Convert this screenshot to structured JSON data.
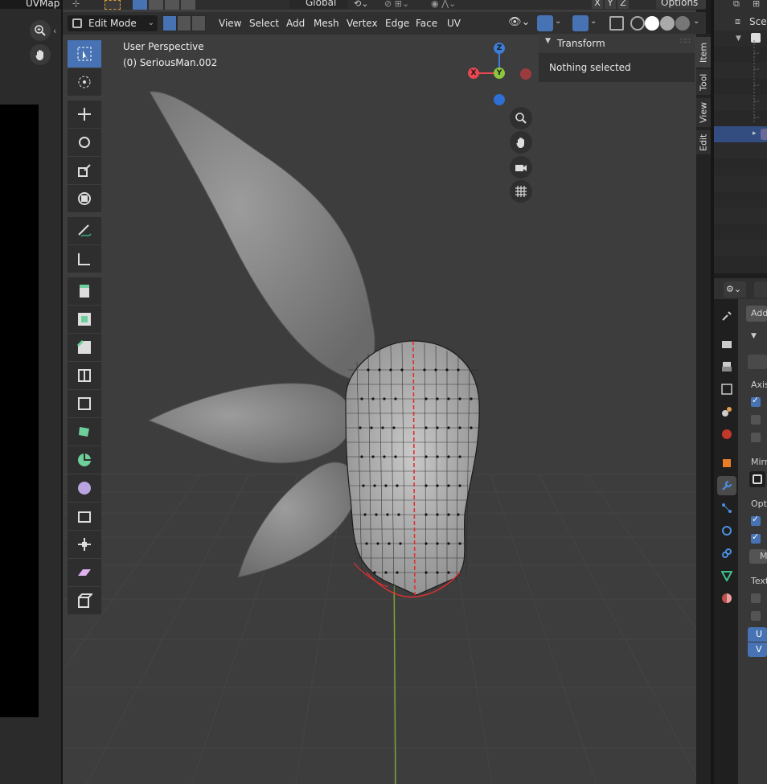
{
  "uv_editor": {
    "uv_map_label": "UVMap"
  },
  "viewport_header": {
    "mode": "Edit Mode",
    "menus": [
      "View",
      "Select",
      "Add",
      "Mesh",
      "Vertex",
      "Edge",
      "Face",
      "UV"
    ],
    "transform_orientation": "Global",
    "axes": [
      "X",
      "Y",
      "Z"
    ],
    "options_label": "Options"
  },
  "viewport": {
    "perspective_label": "User Perspective",
    "object_label": "(0) SeriousMan.002"
  },
  "gizmo": {
    "z": "Z",
    "x": "X",
    "y": "Y"
  },
  "npanel": {
    "section_title": "Transform",
    "message": "Nothing selected",
    "tabs": [
      "Item",
      "Tool",
      "View",
      "Edit"
    ]
  },
  "outliner": {
    "scene_label": "Scen"
  },
  "properties": {
    "add_label": "Add",
    "axis_label": "Axis",
    "mirror_label": "Mirr",
    "options_label": "Opti",
    "m_label": "M",
    "texture_label": "Text",
    "u_label": "U",
    "v_label": "V"
  },
  "colors": {
    "accent": "#4772b3",
    "viewport_bg": "#3d3d3d",
    "edge_seam": "#e03030",
    "axis_x": "#e8474f",
    "axis_y": "#8cc63f",
    "axis_z": "#3b7dd8"
  }
}
